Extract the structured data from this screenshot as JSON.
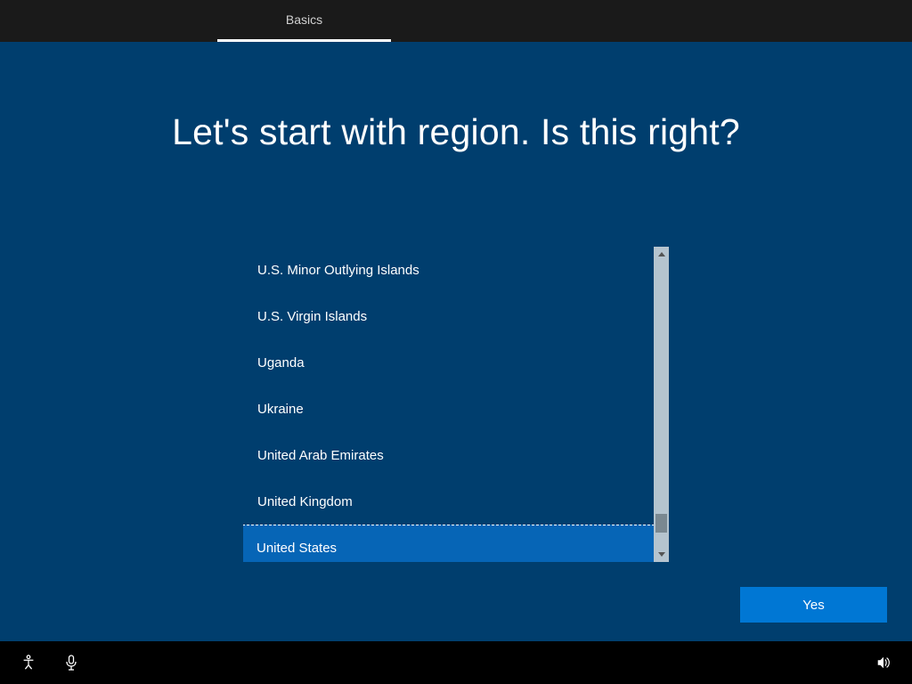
{
  "header": {
    "tab_label": "Basics"
  },
  "heading": "Let's start with region. Is this right?",
  "regions": [
    {
      "label": "U.S. Minor Outlying Islands",
      "selected": false
    },
    {
      "label": "U.S. Virgin Islands",
      "selected": false
    },
    {
      "label": "Uganda",
      "selected": false
    },
    {
      "label": "Ukraine",
      "selected": false
    },
    {
      "label": "United Arab Emirates",
      "selected": false
    },
    {
      "label": "United Kingdom",
      "selected": false
    },
    {
      "label": "United States",
      "selected": true
    }
  ],
  "buttons": {
    "yes": "Yes"
  }
}
